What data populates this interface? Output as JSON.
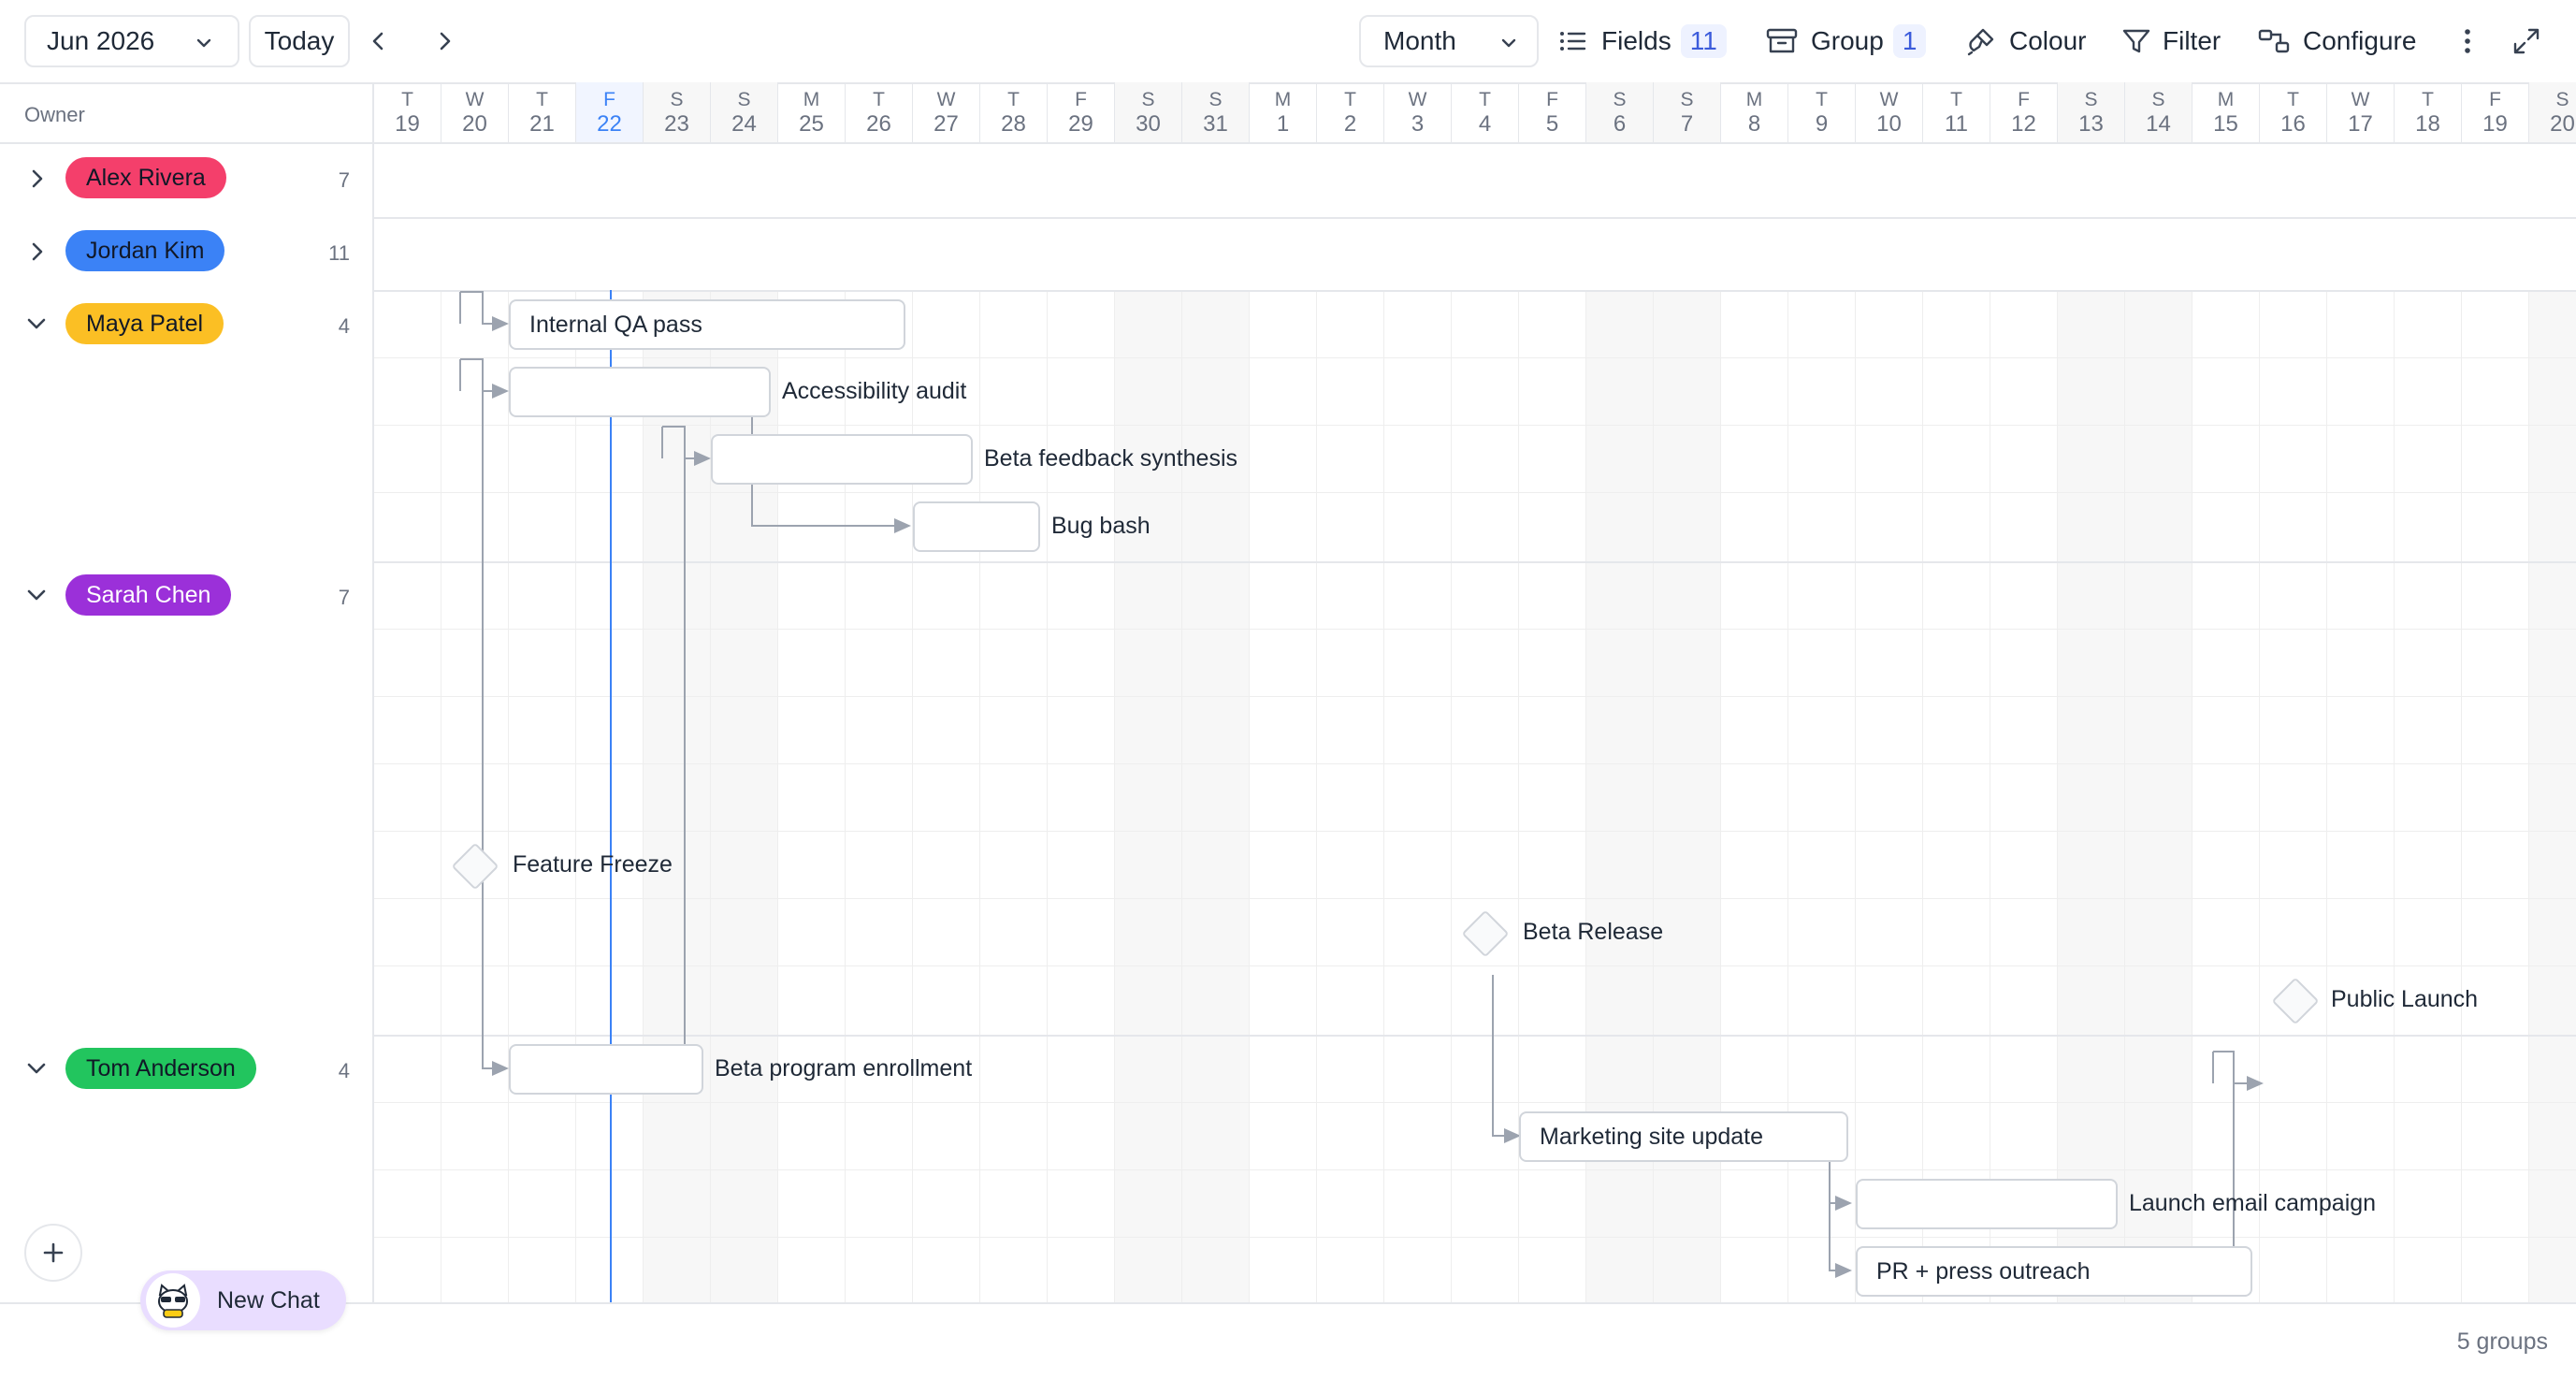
{
  "toolbar": {
    "month_selector": "Jun 2026",
    "today_label": "Today",
    "view_selector": "Month",
    "fields_label": "Fields",
    "fields_count": "11",
    "group_label": "Group",
    "group_count": "1",
    "colour_label": "Colour",
    "filter_label": "Filter",
    "configure_label": "Configure"
  },
  "owner_header": "Owner",
  "days": [
    {
      "dow": "T",
      "d": "19"
    },
    {
      "dow": "W",
      "d": "20"
    },
    {
      "dow": "T",
      "d": "21"
    },
    {
      "dow": "F",
      "d": "22",
      "today": true
    },
    {
      "dow": "S",
      "d": "23",
      "weekend": true
    },
    {
      "dow": "S",
      "d": "24",
      "weekend": true
    },
    {
      "dow": "M",
      "d": "25"
    },
    {
      "dow": "T",
      "d": "26"
    },
    {
      "dow": "W",
      "d": "27"
    },
    {
      "dow": "T",
      "d": "28"
    },
    {
      "dow": "F",
      "d": "29"
    },
    {
      "dow": "S",
      "d": "30",
      "weekend": true
    },
    {
      "dow": "S",
      "d": "31",
      "weekend": true
    },
    {
      "dow": "M",
      "d": "1"
    },
    {
      "dow": "T",
      "d": "2"
    },
    {
      "dow": "W",
      "d": "3"
    },
    {
      "dow": "T",
      "d": "4"
    },
    {
      "dow": "F",
      "d": "5"
    },
    {
      "dow": "S",
      "d": "6",
      "weekend": true
    },
    {
      "dow": "S",
      "d": "7",
      "weekend": true
    },
    {
      "dow": "M",
      "d": "8"
    },
    {
      "dow": "T",
      "d": "9"
    },
    {
      "dow": "W",
      "d": "10"
    },
    {
      "dow": "T",
      "d": "11"
    },
    {
      "dow": "F",
      "d": "12"
    },
    {
      "dow": "S",
      "d": "13",
      "weekend": true
    },
    {
      "dow": "S",
      "d": "14",
      "weekend": true
    },
    {
      "dow": "M",
      "d": "15"
    },
    {
      "dow": "T",
      "d": "16"
    },
    {
      "dow": "W",
      "d": "17"
    },
    {
      "dow": "T",
      "d": "18"
    },
    {
      "dow": "F",
      "d": "19"
    },
    {
      "dow": "S",
      "d": "20",
      "weekend": true
    }
  ],
  "groups": [
    {
      "name": "Alex Rivera",
      "count": "7",
      "color": "#f43f6b",
      "expanded": false
    },
    {
      "name": "Jordan Kim",
      "count": "11",
      "color": "#3b82f6",
      "expanded": false
    },
    {
      "name": "Maya Patel",
      "count": "4",
      "color": "#fbbf24",
      "expanded": true
    },
    {
      "name": "Sarah Chen",
      "count": "7",
      "color": "#9b30d9",
      "expanded": true
    },
    {
      "name": "Tom Anderson",
      "count": "4",
      "color": "#22c55e",
      "expanded": true
    }
  ],
  "tasks": {
    "internal_qa": "Internal QA pass",
    "accessibility": "Accessibility audit",
    "beta_feedback": "Beta feedback synthesis",
    "bug_bash": "Bug bash",
    "feature_freeze": "Feature Freeze",
    "beta_release": "Beta Release",
    "public_launch": "Public Launch",
    "beta_enrollment": "Beta program enrollment",
    "marketing_site": "Marketing site update",
    "launch_email": "Launch email campaign",
    "pr_outreach": "PR + press outreach"
  },
  "footer": {
    "groups_count": "5 groups"
  },
  "new_chat_label": "New Chat",
  "colors": {
    "accent": "#3b82f6",
    "today_line": "#3b82f6"
  }
}
